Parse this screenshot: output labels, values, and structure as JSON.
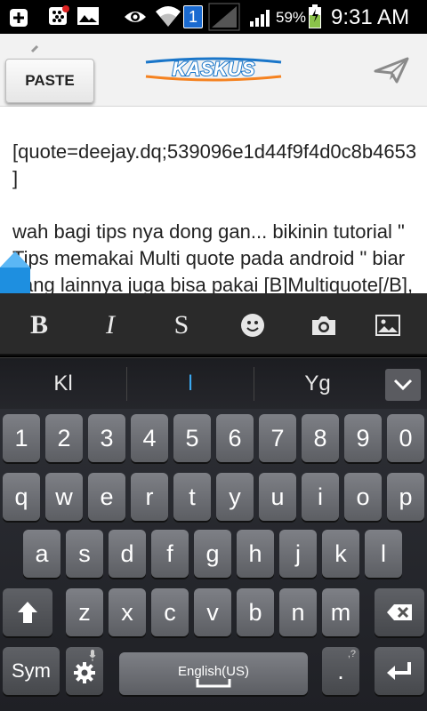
{
  "status_bar": {
    "notification_count": "1",
    "battery_percent": "59%",
    "time": "9:31 AM"
  },
  "action_bar": {
    "paste_label": "PASTE",
    "logo_text": "KASKUS"
  },
  "editor": {
    "text": "[quote=deejay.dq;539096e1d44f9f4d0c8b4653]\n\nwah bagi tips nya dong gan... bikinin tutorial \" Tips memakai Multi quote pada android \" biar yang lainnya juga bisa pakai [B]Multiquote[/B], siapa tahu nanti bisa"
  },
  "toolbar": {
    "bold": "B",
    "italic": "I",
    "strike": "S"
  },
  "suggestions": {
    "left": "Kl",
    "middle": "l",
    "right": "Yg"
  },
  "keyboard": {
    "numbers": [
      "1",
      "2",
      "3",
      "4",
      "5",
      "6",
      "7",
      "8",
      "9",
      "0"
    ],
    "row1": [
      "q",
      "w",
      "e",
      "r",
      "t",
      "y",
      "u",
      "i",
      "o",
      "p"
    ],
    "row2": [
      "a",
      "s",
      "d",
      "f",
      "g",
      "h",
      "j",
      "k",
      "l"
    ],
    "row3": [
      "z",
      "x",
      "c",
      "v",
      "b",
      "n",
      "m"
    ],
    "sym": "Sym",
    "space": "English(US)",
    "period": ".",
    "period_alt": ",?"
  },
  "colors": {
    "accent_blue": "#1e8fe0",
    "logo_blue": "#1a76c9",
    "logo_orange": "#f58220"
  }
}
